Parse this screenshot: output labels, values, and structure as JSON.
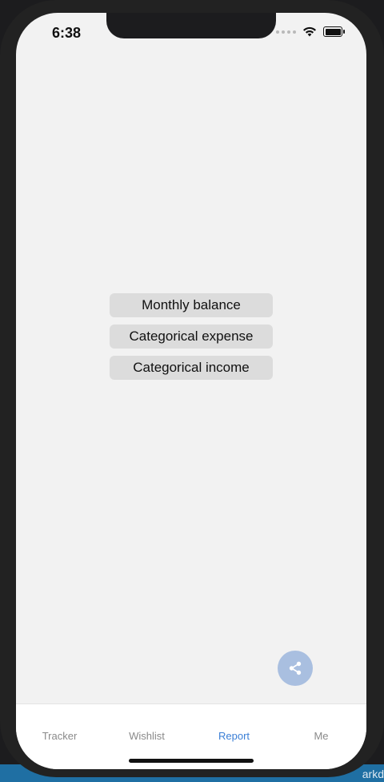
{
  "status_bar": {
    "time": "6:38"
  },
  "report": {
    "buttons": [
      {
        "label": "Monthly balance"
      },
      {
        "label": "Categorical expense"
      },
      {
        "label": "Categorical income"
      }
    ]
  },
  "fab": {
    "icon": "share-icon",
    "color": "#a9bfe0"
  },
  "tab_bar": {
    "tabs": [
      {
        "label": "Tracker"
      },
      {
        "label": "Wishlist"
      },
      {
        "label": "Report"
      },
      {
        "label": "Me"
      }
    ],
    "active_tab": "Report",
    "active_color": "#3b7fd6"
  },
  "background_strip": {
    "text": "arkd"
  }
}
